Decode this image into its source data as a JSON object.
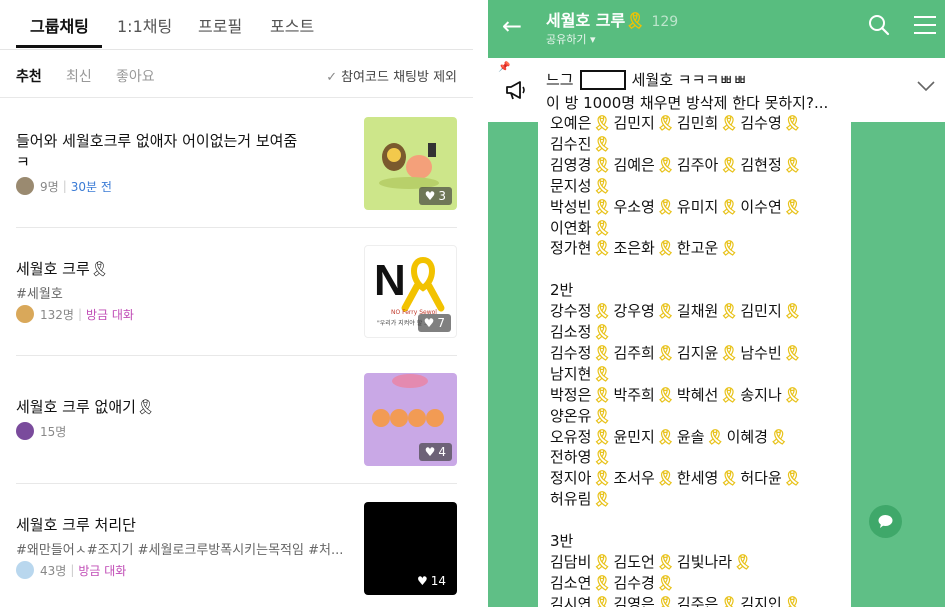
{
  "left": {
    "tabs": [
      "그룹채팅",
      "1:1채팅",
      "프로필",
      "포스트"
    ],
    "filters": [
      "추천",
      "최신",
      "좋아요"
    ],
    "exclude_label": "참여코드 채팅방 제외",
    "items": [
      {
        "title": "들어와 세월호크루 없애자 어이없는거 보여줌",
        "title2": "ㅋ",
        "tags": "",
        "count": "9명",
        "time": "30분 전",
        "likes": "3"
      },
      {
        "title": "세월호 크루🎗",
        "title2": "",
        "tags": "#세월호",
        "count": "132명",
        "time": "방금 대화",
        "likes": "7"
      },
      {
        "title": "세월호 크루 없애기🎗",
        "title2": "",
        "tags": "",
        "count": "15명",
        "time": "",
        "likes": "4"
      },
      {
        "title": "세월호 크루 처리단",
        "title2": "",
        "tags": "#왜만들어ㅅ#조지기 #세월로크루방폭시키는목적임 #처...",
        "count": "43명",
        "time": "방금 대화",
        "likes": "14"
      }
    ],
    "thumb2_letter": "N",
    "thumb2_caption1": "NO Ferry Sewol",
    "thumb2_caption2": "\"우리가 지켜야 할 ...\"",
    "colors": {
      "time_blue": "#3a7bd5",
      "active_purple": "#c04cb6"
    }
  },
  "right": {
    "title": "세월호 크루",
    "count": "129",
    "share": "공유하기",
    "notice_prefix": "느그",
    "notice_l1": "세월호 ㅋㅋㅋㅃㅃ",
    "notice_l2": "이 방 1000명 채우면 방삭제 한다 못하지?...",
    "lines": [
      "오예은🎗김민지🎗김민희🎗김수영🎗",
      "김수진🎗",
      "김영경🎗김예은🎗김주아🎗김현정🎗",
      "문지성🎗",
      "박성빈🎗우소영🎗유미지🎗이수연🎗",
      "이연화🎗",
      "정가현🎗조은화🎗한고운🎗",
      "",
      "2반",
      "강수정🎗강우영🎗길채원🎗김민지🎗",
      "김소정🎗",
      "김수정🎗김주희🎗김지윤🎗남수빈🎗",
      "남지현🎗",
      "박정은🎗박주희🎗박혜선🎗송지나🎗",
      "양온유🎗",
      "오유정🎗윤민지🎗윤솔🎗이혜경🎗",
      "전하영🎗",
      "정지아🎗조서우🎗한세영🎗허다윤🎗",
      "허유림🎗",
      "",
      "3반",
      "김담비🎗김도언🎗김빛나라🎗",
      "김소연🎗김수경🎗",
      "김시연🎗김영은🎗김주은🎗김지인🎗"
    ],
    "colors": {
      "bg_green": "#5fbf86",
      "ribbon_yellow": "#e8c21a"
    }
  }
}
